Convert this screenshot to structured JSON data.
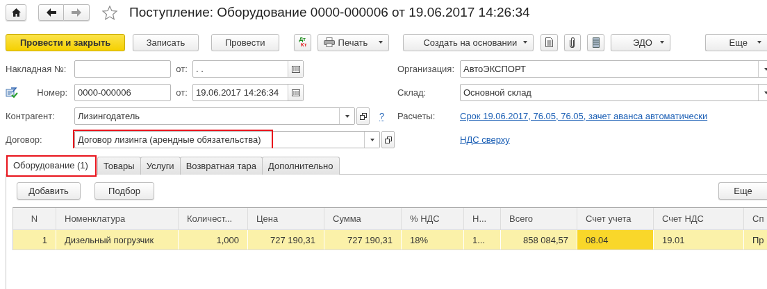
{
  "window": {
    "title": "Поступление: Оборудование 0000-000006 от 19.06.2017 14:26:34"
  },
  "toolbar": [
    {
      "kind": "primary",
      "label": "Провести и закрыть"
    },
    {
      "kind": "button",
      "label": "Записать"
    },
    {
      "kind": "button",
      "label": "Провести"
    },
    {
      "kind": "dtkt",
      "lines": [
        "Дт",
        "Кт"
      ]
    },
    {
      "kind": "print",
      "label": "Печать"
    },
    {
      "kind": "dropdown",
      "label": "Создать на основании"
    },
    {
      "kind": "report"
    },
    {
      "kind": "clip"
    },
    {
      "kind": "stack"
    },
    {
      "kind": "dropdown",
      "label": "ЭДО"
    },
    {
      "kind": "more",
      "label": "Еще"
    }
  ],
  "invoice": {
    "label": "Накладная  №:",
    "date_label": "от:",
    "date_value": " .  ."
  },
  "number": {
    "label": "Номер:",
    "value": "0000-000006",
    "date_label": "от:",
    "date_value": "19.06.2017 14:26:34"
  },
  "counterparty": {
    "label": "Контрагент:",
    "value": "Лизингодатель",
    "help": "?"
  },
  "contract": {
    "label": "Договор:",
    "value": "Договор лизинга (арендные обязательства)",
    "highlighted": true
  },
  "organization": {
    "label": "Организация:",
    "value": "АвтоЭКСПОРТ"
  },
  "warehouse": {
    "label": "Склад:",
    "value": "Основной склад"
  },
  "settlements": {
    "label": "Расчеты:",
    "link": "Срок 19.06.2017, 76.05, 76.05, зачет аванса автоматически"
  },
  "vat_link": "НДС сверху",
  "tabs": [
    {
      "label": "Оборудование (1)",
      "selected": true,
      "highlighted": true
    },
    {
      "label": "Товары",
      "selected": false,
      "highlighted": false
    },
    {
      "label": "Услуги",
      "selected": false,
      "highlighted": false
    },
    {
      "label": "Возвратная тара",
      "selected": false,
      "highlighted": false
    },
    {
      "label": "Дополнительно",
      "selected": false,
      "highlighted": false
    }
  ],
  "tab_buttons": [
    "Добавить",
    "Подбор"
  ],
  "tab_more": "Еще",
  "table": {
    "columns": [
      {
        "label": "N",
        "kind": "number"
      },
      {
        "label": "Номенклатура",
        "kind": "text"
      },
      {
        "label": "Количест...",
        "kind": "number"
      },
      {
        "label": "Цена",
        "kind": "number"
      },
      {
        "label": "Сумма",
        "kind": "number"
      },
      {
        "label": "% НДС",
        "kind": "text"
      },
      {
        "label": "Н...",
        "kind": "text"
      },
      {
        "label": "Всего",
        "kind": "number"
      },
      {
        "label": "Счет учета",
        "kind": "text"
      },
      {
        "label": "Счет НДС",
        "kind": "text"
      },
      {
        "label": "Сп",
        "kind": "text"
      }
    ],
    "rows": [
      {
        "selected": true,
        "cells": [
          {
            "text": "1",
            "active": false
          },
          {
            "text": "Дизельный погрузчик",
            "active": false
          },
          {
            "text": "1,000",
            "active": false
          },
          {
            "text": "727 190,31",
            "active": false
          },
          {
            "text": "727 190,31",
            "active": false
          },
          {
            "text": "18%",
            "active": false
          },
          {
            "text": "1...",
            "active": false
          },
          {
            "text": "858 084,57",
            "active": false
          },
          {
            "text": "08.04",
            "active": true
          },
          {
            "text": "19.01",
            "active": false
          },
          {
            "text": "Пр",
            "active": false
          }
        ]
      }
    ]
  }
}
